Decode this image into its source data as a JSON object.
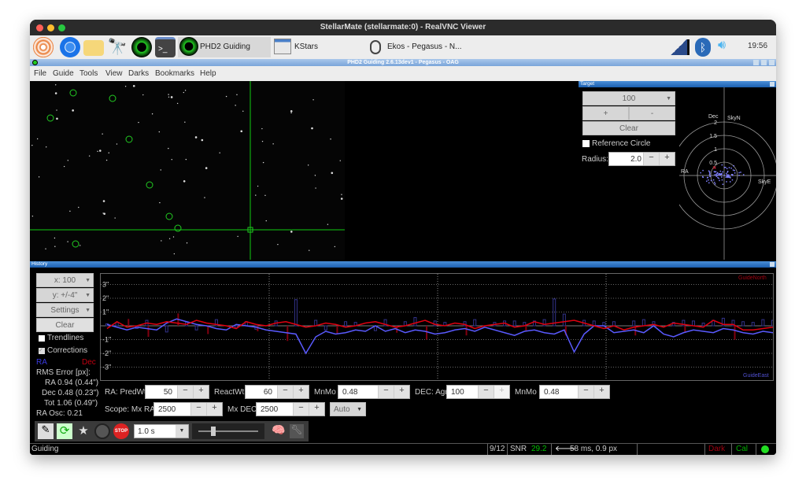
{
  "window": {
    "title": "StellarMate (stellarmate:0) - RealVNC Viewer"
  },
  "taskbar": {
    "tasks": [
      {
        "label": "PHD2 Guiding 2.6.1..."
      },
      {
        "label": "KStars"
      },
      {
        "label": "Ekos - Pegasus - N..."
      }
    ],
    "clock": "19:56",
    "icons": [
      "raspberry-menu-icon",
      "chromium-icon",
      "file-manager-icon",
      "telescope-icon",
      "phd2-icon",
      "terminal-icon"
    ]
  },
  "phd": {
    "title": "PHD2 Guiding 2.6.13dev1 - Pegasus - OAG",
    "menu": [
      "File",
      "Guide",
      "Tools",
      "View",
      "Darks",
      "Bookmarks",
      "Help"
    ]
  },
  "target": {
    "title": "Target",
    "zoom": "100",
    "plus": "+",
    "minus": "-",
    "clear": "Clear",
    "reference_circle": "Reference Circle",
    "reference_checked": false,
    "radius_label": "Radius:",
    "radius": "2.0",
    "labels": {
      "dec": "Dec",
      "skyn": "SkyN",
      "ra": "RA",
      "skye": "SkyE",
      "rings": [
        "2",
        "1.5",
        "1",
        "0.5"
      ]
    }
  },
  "history": {
    "title": "History",
    "x_scale": "x: 100",
    "y_scale": "y: +/-4\"",
    "settings": "Settings",
    "clear": "Clear",
    "trendlines": "Trendlines",
    "trendlines_checked": false,
    "corrections": "Corrections",
    "corrections_checked": true,
    "ra_label": "RA",
    "dec_label": "Dec",
    "rms_label": "RMS Error [px]:",
    "rms_ra": "RA 0.94 (0.44\")",
    "rms_dec": "Dec 0.48 (0.23\")",
    "rms_tot": "Tot 1.06 (0.49\")",
    "ra_osc": "RA Osc: 0.21",
    "guide_north": "GuideNorth",
    "guide_east": "GuideEast",
    "controls": {
      "ra_predwt_label": "RA: PredWt",
      "ra_predwt": "50",
      "reactwt_label": "ReactWt",
      "reactwt": "60",
      "mnmo_label": "MnMo",
      "ra_mnmo": "0.48",
      "dec_agr_label": "DEC: Agr",
      "dec_agr": "100",
      "dec_mnmo": "0.48",
      "scope_mxra_label": "Scope: Mx RA",
      "mx_ra": "2500",
      "mx_dec_label": "Mx DEC",
      "mx_dec": "2500",
      "mode": "Auto"
    }
  },
  "colors": {
    "ra": "#5a5aff",
    "dec": "#e00010",
    "accent": "#1c5fb0",
    "snr": "#00c000"
  },
  "chart_data": {
    "type": "line",
    "y_ticks": [
      "3\"",
      "2\"",
      "1\"",
      "-1\"",
      "-2\"",
      "-3\""
    ],
    "ylim": [
      -4,
      4
    ],
    "grid": true,
    "series": [
      {
        "name": "RA",
        "values": [
          0.1,
          -0.1,
          -0.3,
          -0.1,
          -0.2,
          -0.3,
          0.2,
          0.5,
          0.3,
          0.1,
          0.0,
          -0.2,
          -0.3,
          0.1,
          0.0,
          -0.1,
          -0.3,
          -0.4,
          -0.5,
          -0.6,
          -2.0,
          -0.8,
          -0.4,
          -0.6,
          -0.5,
          -0.3,
          -0.4,
          0.0,
          -0.4,
          -0.2,
          -0.5,
          -0.3,
          -0.4,
          -0.6,
          -0.5,
          -0.3,
          -0.2,
          -0.4,
          -0.1,
          -0.3,
          -0.5,
          -0.7,
          -0.4,
          -0.3,
          -0.5,
          -0.6,
          -0.3,
          -1.9,
          -0.6,
          0.0,
          0.0,
          -0.5,
          -0.4,
          -0.3,
          -0.5,
          0.0,
          -0.6,
          -0.8,
          -0.5,
          -0.3,
          -0.4,
          -0.5,
          -0.2,
          -0.3,
          -0.5,
          -0.6,
          -0.4,
          -0.5
        ]
      },
      {
        "name": "Dec",
        "values": [
          -0.2,
          0.3,
          -0.1,
          0.0,
          0.2,
          0.1,
          0.3,
          0.2,
          0.1,
          0.4,
          0.2,
          0.1,
          0.0,
          -0.2,
          0.3,
          0.1,
          0.0,
          0.2,
          0.3,
          0.1,
          -0.1,
          0.0,
          0.2,
          0.1,
          -0.1,
          0.0,
          0.2,
          0.3,
          0.1,
          -0.1,
          0.0,
          0.2,
          0.4,
          0.1,
          0.0,
          0.2,
          0.1,
          -0.2,
          0.0,
          0.1,
          0.2,
          -0.1,
          0.0,
          0.3,
          0.1,
          0.2,
          0.3,
          0.4,
          0.2,
          0.0,
          -0.2,
          0.0,
          -0.3,
          -0.1,
          0.0,
          0.1,
          -0.1,
          0.2,
          0.1,
          0.0,
          -0.1,
          0.4,
          0.1,
          0.1,
          -0.3,
          -0.3,
          -0.2,
          -0.1
        ]
      }
    ],
    "ra_corrections": [
      0.3,
      0.5,
      0,
      -0.4,
      0.8,
      0,
      -0.9,
      0,
      0.5,
      -0.6,
      0,
      0.9,
      0,
      -0.3,
      0.6,
      -0.5,
      0,
      0.7,
      0,
      3.8,
      0,
      0.8,
      -0.6,
      0,
      0.6,
      0.5,
      0,
      -0.7,
      0.9,
      0,
      0.6,
      1.2,
      0,
      0.7,
      0.5,
      0,
      0.6,
      0.9,
      0,
      0.5,
      0.7,
      0.7,
      0.5,
      0.7,
      0.9,
      3.9,
      1.7,
      0,
      0.8,
      0.7,
      0.5,
      0.6,
      0,
      0.7,
      0.9,
      0.6,
      0,
      0.5,
      0.8,
      0.7,
      0.4,
      0.8,
      1.1,
      0.8,
      0.6,
      0.5,
      0.9,
      0.8
    ],
    "dec_corrections": [
      0,
      0,
      0.5,
      0,
      -0.8,
      0,
      0,
      0.9,
      0,
      0,
      -0.6,
      0,
      0,
      0,
      0,
      -0.4,
      0,
      0,
      -1.1,
      0,
      0,
      0,
      0,
      -0.6,
      0,
      0,
      0,
      0,
      0,
      -0.5,
      0,
      0,
      -1.0,
      0,
      0,
      0,
      -0.7,
      0,
      0,
      0,
      0,
      0,
      -0.4,
      0,
      0,
      0,
      -0.7,
      0,
      0,
      0,
      0,
      0,
      0,
      -0.7,
      0,
      0,
      0,
      0,
      -0.5,
      0,
      0,
      0,
      0,
      -1.0,
      0,
      0,
      0,
      0
    ]
  },
  "toolbar": {
    "exposure": "1.0 s",
    "icons": [
      "pencil-icon",
      "loop-icon",
      "find-star-icon",
      "guide-icon",
      "stop-icon",
      "brain-icon",
      "wrench-icon"
    ]
  },
  "status": {
    "text": "Guiding",
    "frame": "9/12",
    "snr_label": "SNR",
    "snr": "29.2",
    "guide_info": "58 ms, 0.9 px",
    "dark": "Dark",
    "cal": "Cal"
  }
}
